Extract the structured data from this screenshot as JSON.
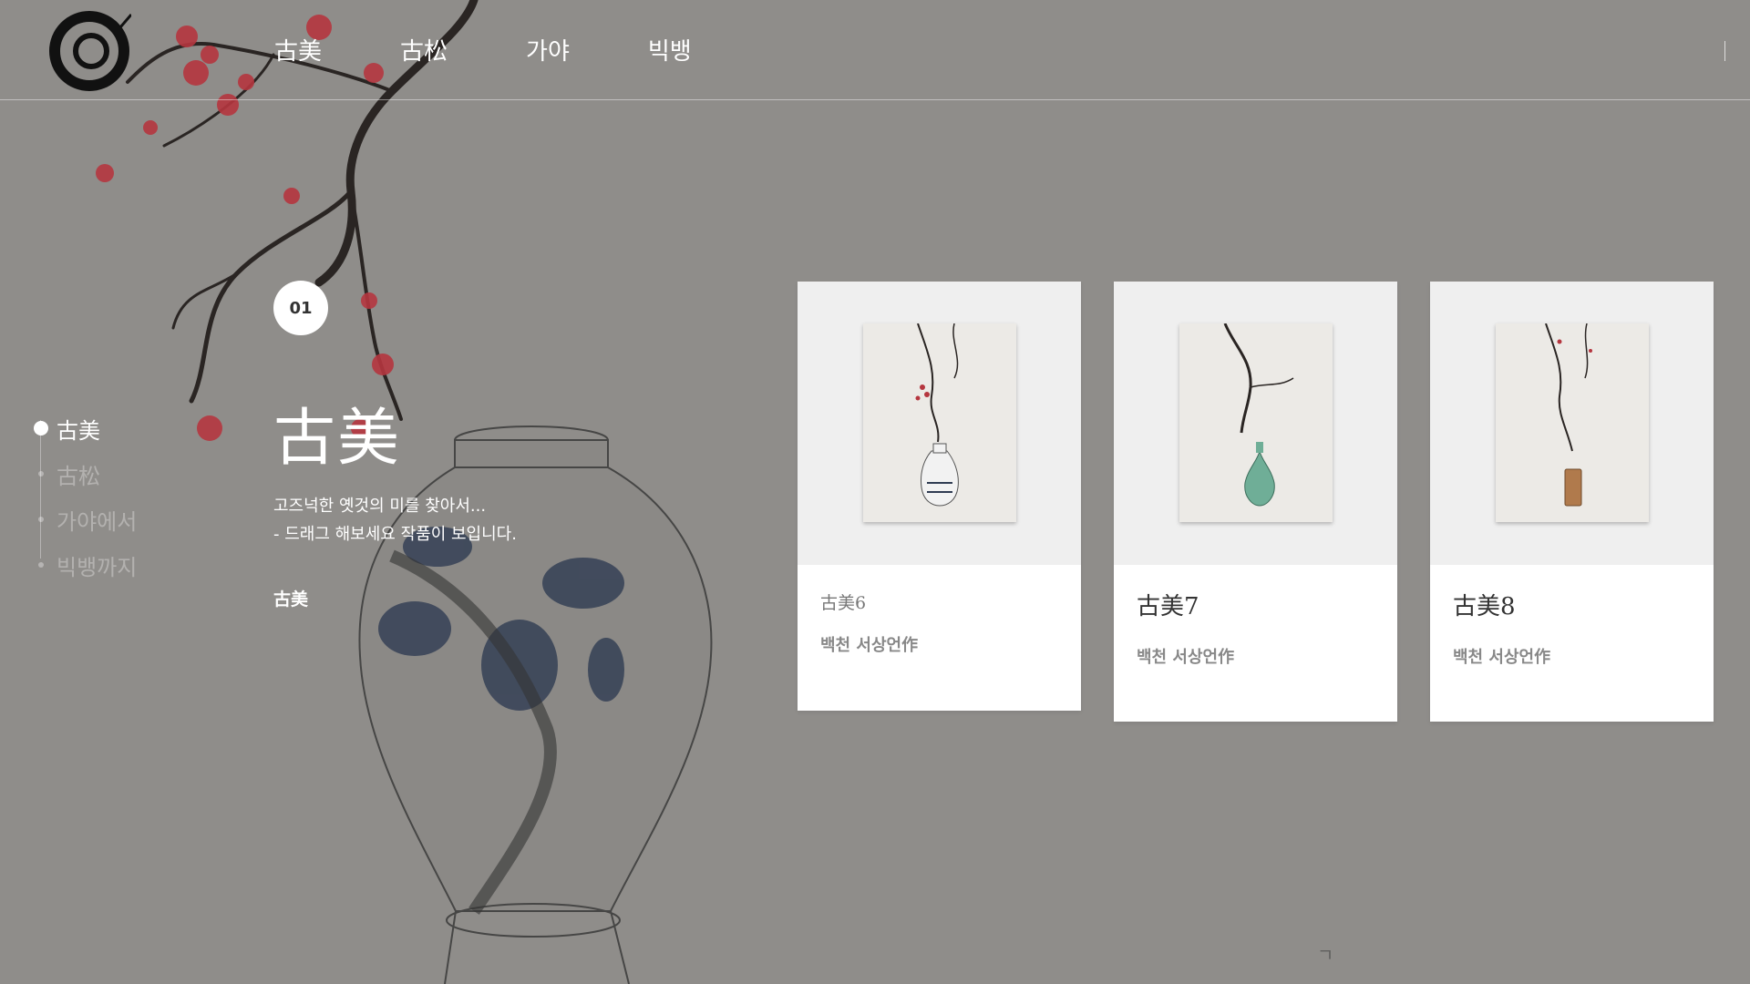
{
  "header": {
    "logo_icon": "ink-circle-logo-icon",
    "nav": [
      {
        "label": "古美"
      },
      {
        "label": "古松"
      },
      {
        "label": "가야"
      },
      {
        "label": "빅뱅"
      }
    ]
  },
  "side_nav": {
    "items": [
      {
        "label": "古美",
        "active": true
      },
      {
        "label": "古松",
        "active": false
      },
      {
        "label": "가야에서",
        "active": false
      },
      {
        "label": "빅뱅까지",
        "active": false
      }
    ]
  },
  "hero": {
    "number": "01",
    "title": "古美",
    "desc_line1": "고즈넉한 옛것의 미를 찾아서...",
    "desc_line2": "- 드래그 해보세요 작품이 보입니다.",
    "tag": "古美"
  },
  "cards": [
    {
      "title": "古美6",
      "author": "백천 서상언作",
      "vase_color": "#f2f2f2"
    },
    {
      "title": "古美7",
      "author": "백천 서상언作",
      "vase_color": "#6fae97"
    },
    {
      "title": "古美8",
      "author": "백천 서상언作",
      "vase_color": "#b07a4c"
    }
  ],
  "colors": {
    "background": "#8f8d8a",
    "card_image_bg": "#efefef",
    "blossom": "#b5363f"
  }
}
